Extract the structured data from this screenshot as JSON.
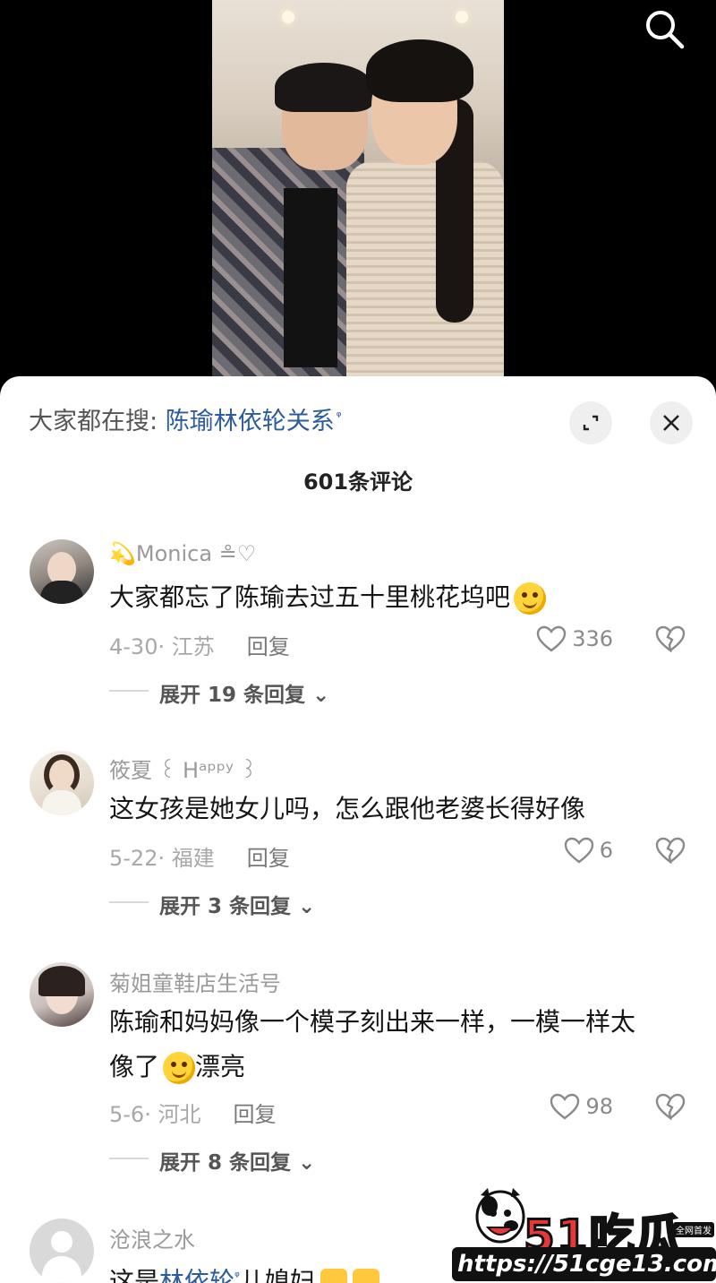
{
  "header": {
    "search_icon": "search-icon"
  },
  "search_hint": {
    "label": "大家都在搜:",
    "query": "陈瑜林依轮关系",
    "search_mark": "ᵠ"
  },
  "buttons": {
    "expand_icon": "expand-icon",
    "close_icon": "close-icon"
  },
  "comment_count": "601条评论",
  "comments": [
    {
      "username": "💫Monica ≗♡",
      "text": "大家都忘了陈瑜去过五十里桃花坞吧",
      "date_location": "4-30· 江苏",
      "reply_label": "回复",
      "likes": "336",
      "expand_label": "展开 19 条回复 ⌄"
    },
    {
      "username": "筱夏 ꒰ Hᵃᵖᵖʸ ꒱",
      "text": "这女孩是她女儿吗，怎么跟他老婆长得好像",
      "date_location": "5-22· 福建",
      "reply_label": "回复",
      "likes": "6",
      "expand_label": "展开 3 条回复 ⌄"
    },
    {
      "username": "菊姐童鞋店生活号",
      "text_line1": "陈瑜和妈妈像一个模子刻出来一样，一模一样太",
      "text_line2_a": "像了",
      "text_line2_b": "漂亮",
      "date_location": "5-6· 河北",
      "reply_label": "回复",
      "likes": "98",
      "expand_label": "展开 8 条回复 ⌄"
    },
    {
      "username": "沧浪之水",
      "text_prefix": "这是",
      "text_link": "林依轮",
      "text_suffix": "儿媳妇"
    }
  ],
  "watermark": {
    "logo_num": "51",
    "logo_text": "吃瓜",
    "badge": "全网首发",
    "url": "https://51cge13.com"
  },
  "colors": {
    "link": "#2c5b9e",
    "background": "#ffffff",
    "video_bg": "#000000"
  }
}
